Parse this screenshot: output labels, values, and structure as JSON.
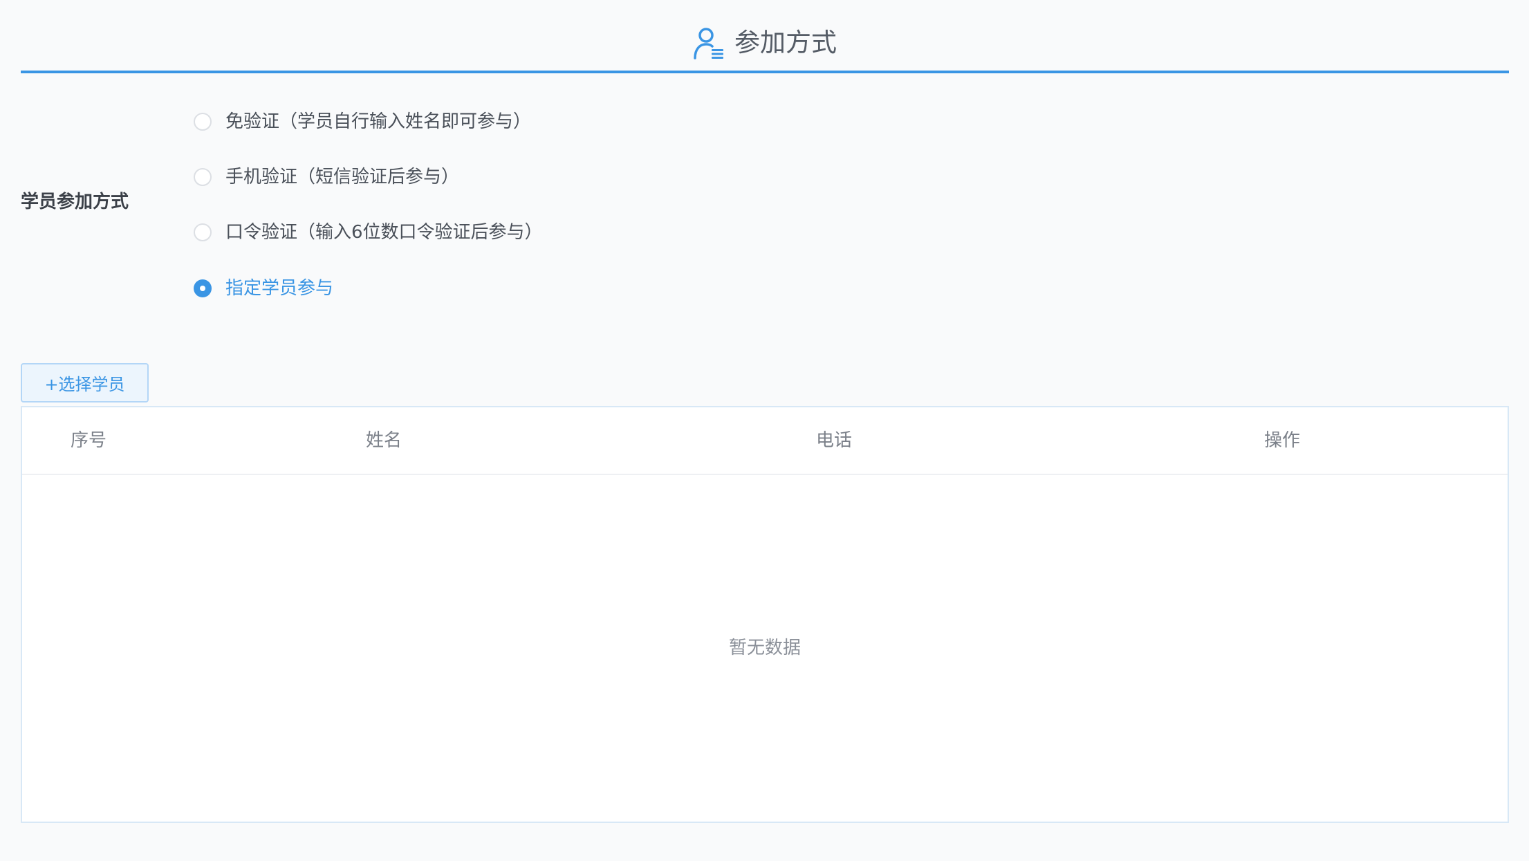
{
  "header": {
    "title": "参加方式",
    "icon": "user-list-icon",
    "accent_color": "#3a95e4"
  },
  "join_method": {
    "label": "学员参加方式",
    "options": [
      {
        "label": "免验证（学员自行输入姓名即可参与）",
        "selected": false
      },
      {
        "label": "手机验证（短信验证后参与）",
        "selected": false
      },
      {
        "label": "口令验证（输入6位数口令验证后参与）",
        "selected": false
      },
      {
        "label": "指定学员参与",
        "selected": true
      }
    ]
  },
  "select_students": {
    "label": "+选择学员"
  },
  "table": {
    "columns": [
      "序号",
      "姓名",
      "电话",
      "操作"
    ],
    "rows": [],
    "empty_text": "暂无数据"
  }
}
